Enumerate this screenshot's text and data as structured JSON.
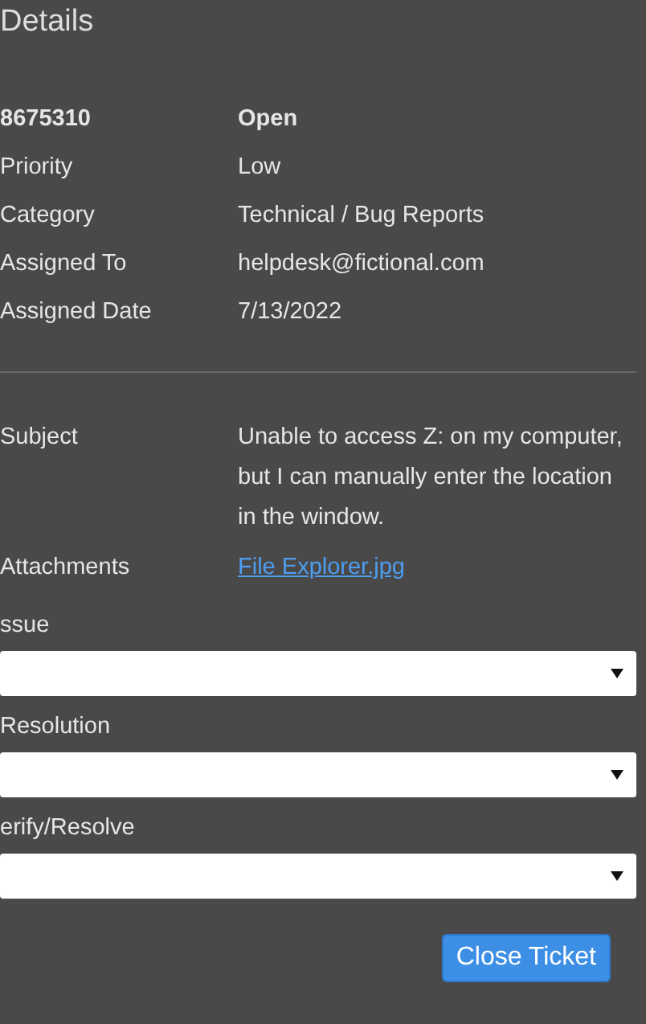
{
  "title": "Details",
  "header": {
    "ticket_number": "8675310",
    "status": "Open"
  },
  "fields": [
    {
      "label": "Priority",
      "value": "Low"
    },
    {
      "label": "Category",
      "value": "Technical / Bug Reports"
    },
    {
      "label": "Assigned To",
      "value": "helpdesk@fictional.com"
    },
    {
      "label": "Assigned Date",
      "value": "7/13/2022"
    }
  ],
  "subject": {
    "label": "Subject",
    "value": "Unable to access Z: on my computer, but I can manually enter the location in the window."
  },
  "attachments": {
    "label": "Attachments",
    "link": "File Explorer.jpg"
  },
  "dropdowns": [
    {
      "label": "ssue"
    },
    {
      "label": "Resolution"
    },
    {
      "label": "erify/Resolve"
    }
  ],
  "button": "Close Ticket"
}
